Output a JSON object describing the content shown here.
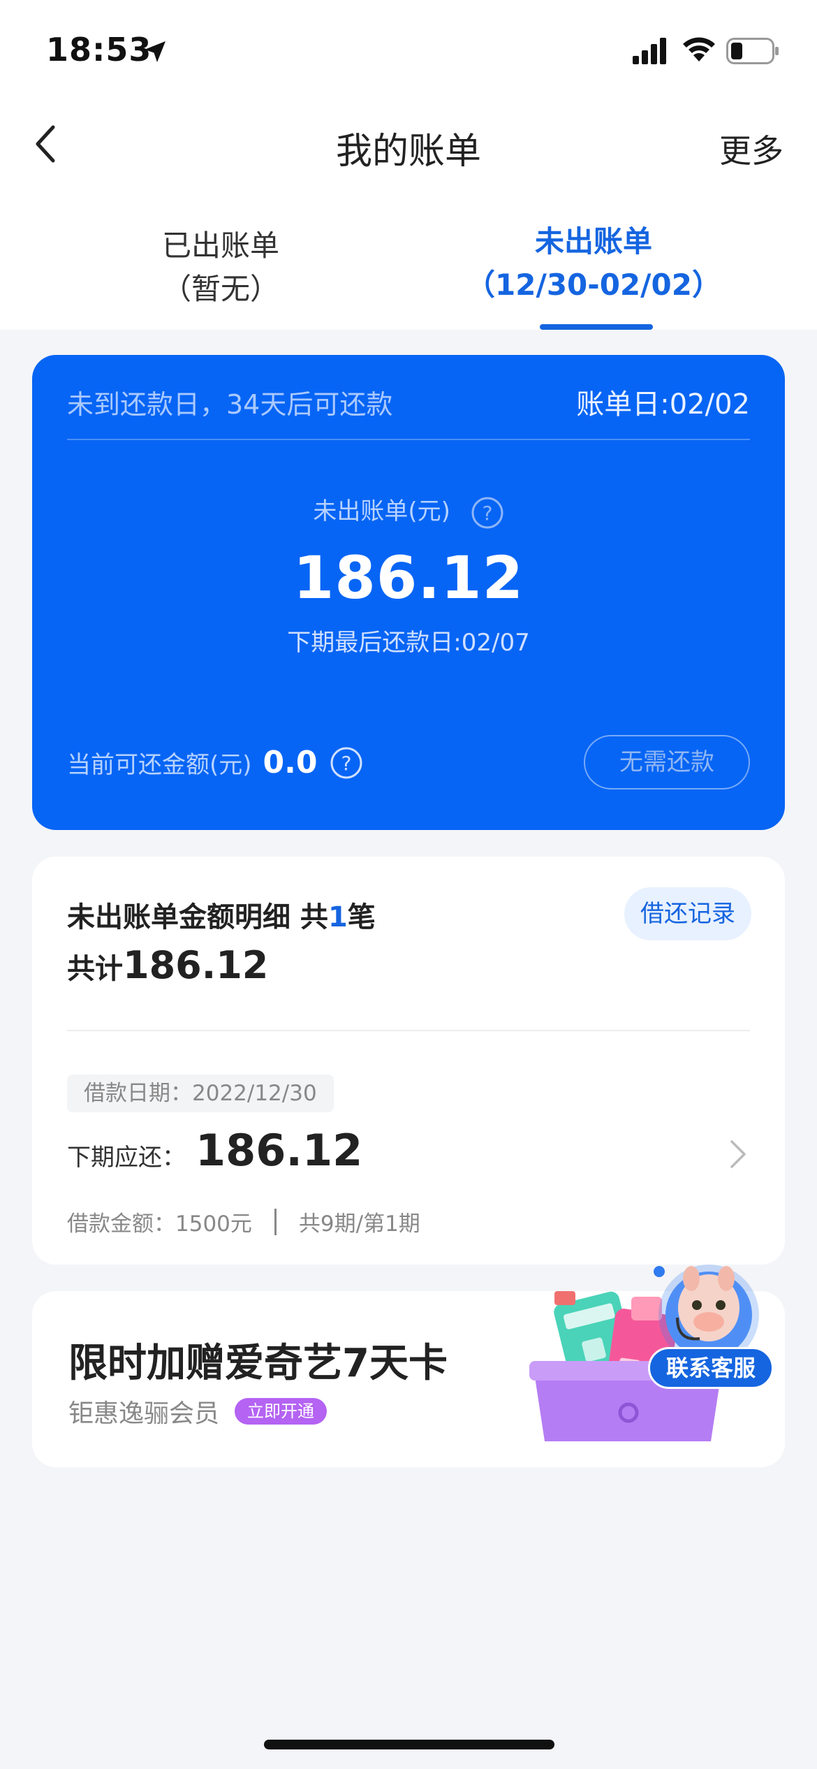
{
  "status_bar": {
    "time": "18:53"
  },
  "nav": {
    "title": "我的账单",
    "more": "更多"
  },
  "tabs": [
    {
      "line1": "已出账单",
      "line2": "（暂无）"
    },
    {
      "line1": "未出账单",
      "line2": "（12/30-02/02）"
    }
  ],
  "summary": {
    "notice": "未到还款日，34天后可还款",
    "bill_day": "账单日:02/02",
    "label": "未出账单(元)",
    "amount": "186.12",
    "next_due": "下期最后还款日:02/07",
    "available_label": "当前可还金额(元)",
    "available_value": "0.0",
    "button": "无需还款"
  },
  "detail": {
    "title_prefix": "未出账单金额明细 共",
    "count": "1",
    "title_suffix": "笔",
    "total_prefix": "共计",
    "total_value": "186.12",
    "record_button": "借还记录",
    "loan_date": "借款日期：2022/12/30",
    "due_label": "下期应还：",
    "due_amount": "186.12",
    "loan_amount": "借款金额：1500元",
    "period": "共9期/第1期"
  },
  "promo": {
    "title": "限时加赠爱奇艺7天卡",
    "subtitle": "钜惠逸骊会员",
    "tag": "立即开通"
  },
  "service": {
    "label": "联系客服"
  },
  "colors": {
    "accent": "#1565e0",
    "card_blue": "#0765f5",
    "promo_tag": "#b463f2"
  }
}
